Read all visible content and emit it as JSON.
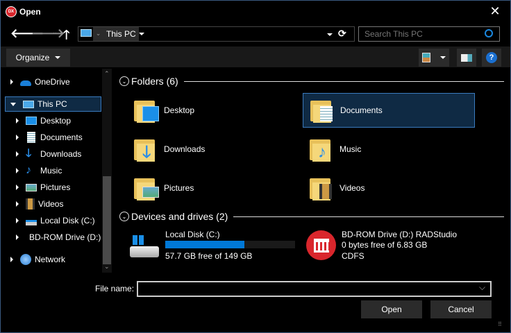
{
  "window": {
    "title": "Open",
    "close_icon": "close-icon"
  },
  "nav": {
    "location": "This PC",
    "search_placeholder": "Search This PC"
  },
  "toolbar": {
    "organize_label": "Organize"
  },
  "sidebar": {
    "items": [
      {
        "label": "OneDrive",
        "icon": "onedrive-icon",
        "level": 0
      },
      {
        "label": "This PC",
        "icon": "this-pc-icon",
        "level": 0,
        "selected": true,
        "expanded": true
      },
      {
        "label": "Desktop",
        "icon": "desktop-icon",
        "level": 1
      },
      {
        "label": "Documents",
        "icon": "documents-icon",
        "level": 1
      },
      {
        "label": "Downloads",
        "icon": "downloads-icon",
        "level": 1
      },
      {
        "label": "Music",
        "icon": "music-icon",
        "level": 1
      },
      {
        "label": "Pictures",
        "icon": "pictures-icon",
        "level": 1
      },
      {
        "label": "Videos",
        "icon": "videos-icon",
        "level": 1
      },
      {
        "label": "Local Disk (C:)",
        "icon": "local-disk-icon",
        "level": 1
      },
      {
        "label": "BD-ROM Drive (D:) RADStudio",
        "icon": "bd-rom-icon",
        "level": 1
      },
      {
        "label": "Network",
        "icon": "network-icon",
        "level": 0
      }
    ]
  },
  "main": {
    "folders_header": "Folders (6)",
    "folders": [
      {
        "label": "Desktop",
        "icon": "desktop-folder-icon"
      },
      {
        "label": "Documents",
        "icon": "documents-folder-icon",
        "selected": true
      },
      {
        "label": "Downloads",
        "icon": "downloads-folder-icon"
      },
      {
        "label": "Music",
        "icon": "music-folder-icon"
      },
      {
        "label": "Pictures",
        "icon": "pictures-folder-icon"
      },
      {
        "label": "Videos",
        "icon": "videos-folder-icon"
      }
    ],
    "drives_header": "Devices and drives (2)",
    "drives": [
      {
        "label": "Local Disk (C:)",
        "free": "57.7 GB free of 149 GB",
        "used_fraction": 0.61,
        "bar_color": "#0078d7"
      },
      {
        "label": "BD-ROM Drive (D:) RADStudio",
        "free": "0 bytes free of 6.83 GB",
        "fs": "CDFS"
      }
    ]
  },
  "footer": {
    "filename_label": "File name:",
    "filename_value": "",
    "open_label": "Open",
    "cancel_label": "Cancel"
  },
  "colors": {
    "accent": "#0078d7",
    "selection": "#0f2a44",
    "selection_border": "#3a7bbf",
    "toolbar_bg": "#191919",
    "button_bg": "#2b2b2b"
  }
}
